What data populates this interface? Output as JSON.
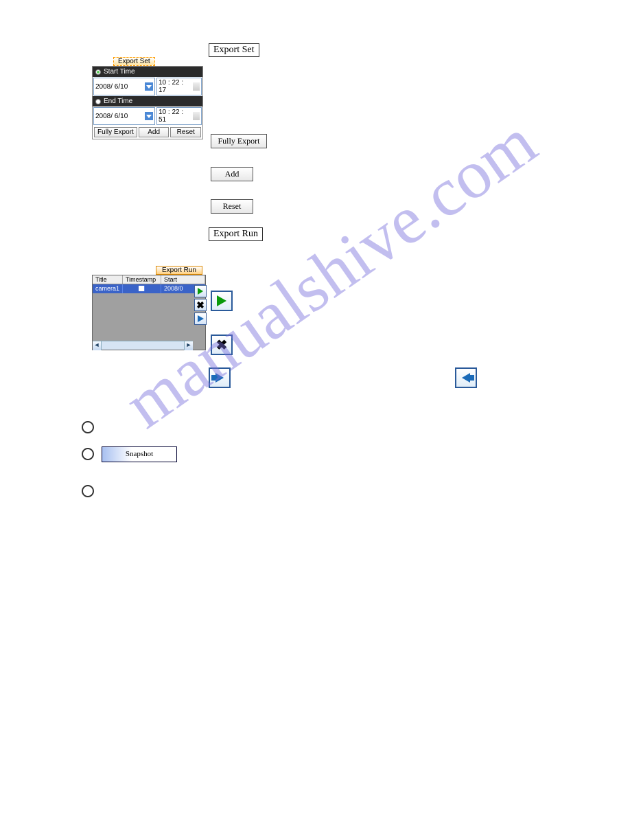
{
  "watermark": "manualshive.com",
  "labels": {
    "export_set": "Export Set",
    "export_run": "Export Run"
  },
  "exportset": {
    "tab": "Export Set",
    "start_label": "Start Time",
    "start_date": "2008/ 6/10",
    "start_time": "10 : 22 : 17",
    "end_label": "End Time",
    "end_date": "2008/ 6/10",
    "end_time": "10 : 22 : 51",
    "btn_fully": "Fully Export",
    "btn_add": "Add",
    "btn_reset": "Reset"
  },
  "std_buttons": {
    "fully": "Fully Export",
    "add": "Add",
    "reset": "Reset"
  },
  "exportrun": {
    "tab": "Export Run",
    "cols": [
      "Title",
      "Timestamp",
      "Start"
    ],
    "row": {
      "title": "camera1",
      "timestamp": "",
      "start": "2008/0"
    }
  },
  "snapshot": "Snapshot"
}
